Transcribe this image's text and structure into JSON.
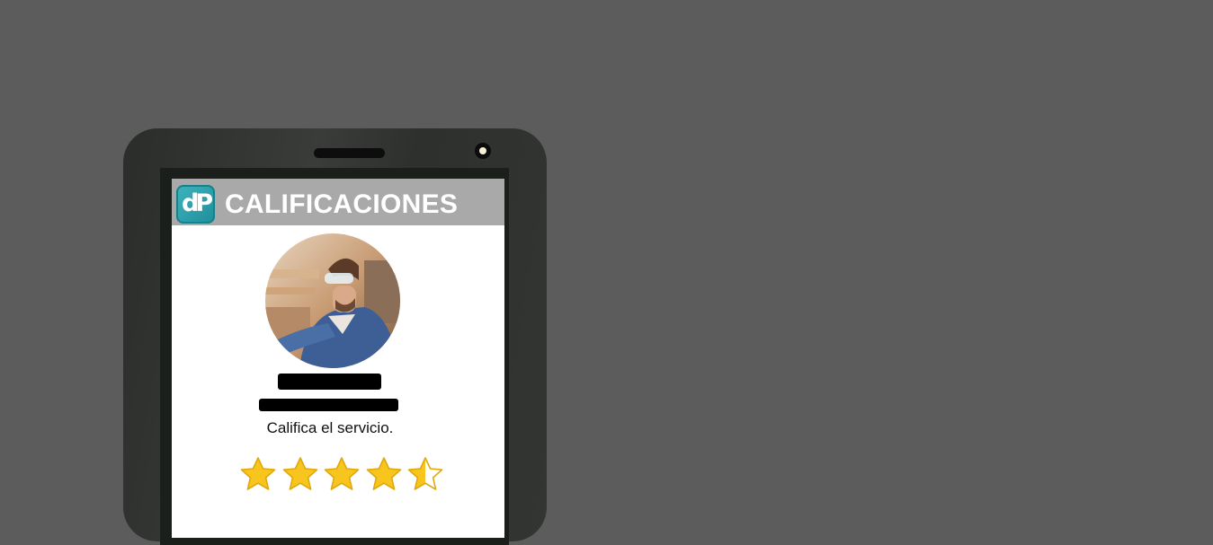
{
  "header": {
    "title": "CALIFICACIONES",
    "logo_text": "dP",
    "background": "#a9a9a9"
  },
  "profile": {
    "photo": "worker-with-safety-goggles",
    "name_redacted": true,
    "subtitle_redacted": true
  },
  "rating": {
    "prompt": "Califica el servicio.",
    "value": 4.5,
    "max": 5,
    "star_color": "#f7c51d"
  },
  "colors": {
    "background": "#5b5c5b",
    "phone": "#2f312f",
    "accent": "#2aa0ab"
  }
}
